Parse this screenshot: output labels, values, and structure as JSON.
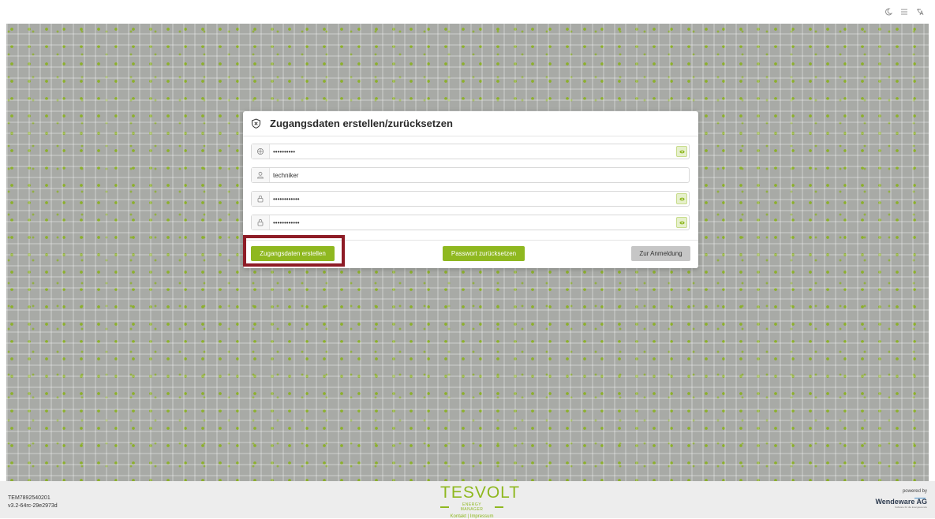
{
  "topbar": {
    "icons": [
      "moon-icon",
      "list-icon",
      "translate-icon"
    ]
  },
  "dialog": {
    "title": "Zugangsdaten erstellen/zurücksetzen",
    "title_icon": "shield-icon",
    "fields": [
      {
        "icon": "key-icon",
        "value": "••••••••••",
        "type": "password",
        "has_toggle": true
      },
      {
        "icon": "user-icon",
        "value": "techniker",
        "type": "text",
        "has_toggle": false
      },
      {
        "icon": "lock-icon",
        "value": "••••••••••••",
        "type": "password",
        "has_toggle": true
      },
      {
        "icon": "lock-icon",
        "value": "••••••••••••",
        "type": "password",
        "has_toggle": true
      }
    ],
    "buttons": {
      "create": "Zugangsdaten erstellen",
      "reset": "Passwort zurücksetzen",
      "back": "Zur Anmeldung"
    }
  },
  "footer": {
    "serial_line1": "TEM7892540201",
    "serial_line2": "v3.2-64rc-29e2973d",
    "brand": "TESVOLT",
    "brand_sub": "ENERGY MANAGER",
    "links": "Kontakt | Impressum",
    "powered_by": "powered by",
    "company": "Wendeware AG",
    "company_sub": "Software für die Energiewende"
  },
  "colors": {
    "accent": "#8fb820",
    "highlight": "#8e1c26",
    "background_pattern": "#a8aaa6"
  }
}
